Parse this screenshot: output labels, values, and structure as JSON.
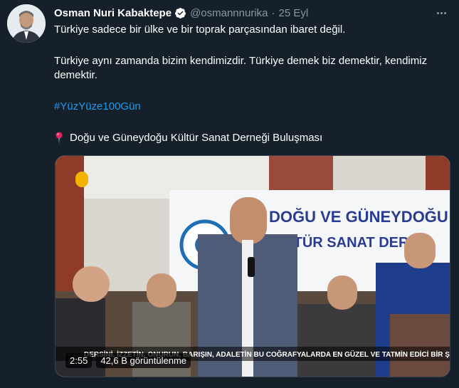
{
  "tweet": {
    "display_name": "Osman Nuri Kabaktepe",
    "handle": "@osmannnurika",
    "separator": "·",
    "date": "25 Eyl",
    "line1": "Türkiye sadece bir ülke ve bir toprak parçasından ibaret değil.",
    "line2": "Türkiye aynı zamanda bizim kendimizdir. Türkiye demek biz demektir, kendimiz demektir.",
    "hashtag": "#YüzYüze100Gün",
    "location": "Doğu ve Güneydoğu Kültür Sanat Derneği Buluşması"
  },
  "media": {
    "banner_line1": "DOĞU VE GÜNEYDOĞU",
    "banner_line2": "KÜLTÜR SANAT DERNE",
    "caption": "DERSİNİ, İZZETİN, ONURUN, BARIŞIN, ADALETİN BU COĞRAFYALARDA EN GÜZEL VE TATMİN EDİCİ BİR ŞEKİLDE",
    "duration": "2:55",
    "views": "42,6 B görüntülenme"
  },
  "icons": {
    "verified": "verified-badge-icon",
    "more": "more-icon",
    "pin": "round-pushpin-icon"
  },
  "colors": {
    "background": "#15202b",
    "link": "#1d9bf0",
    "secondary_text": "#8899a6"
  }
}
